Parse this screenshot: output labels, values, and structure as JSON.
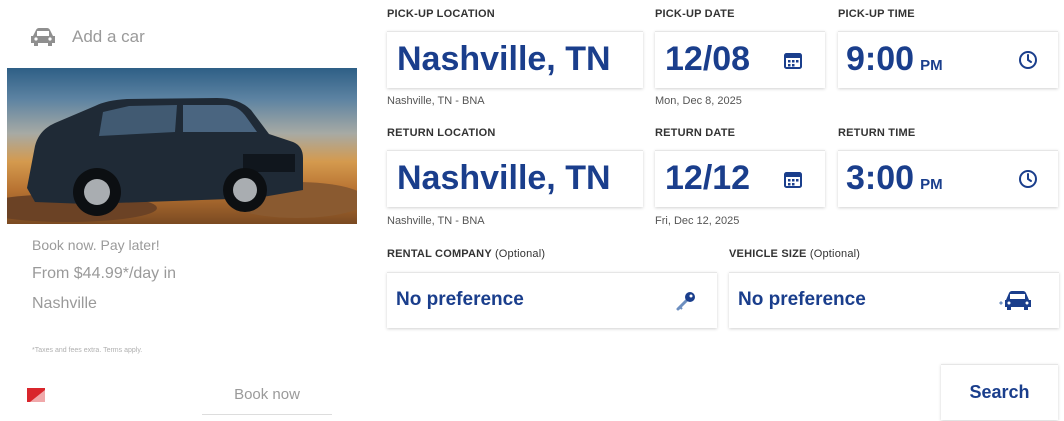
{
  "promo": {
    "add_car": "Add a car",
    "tagline": "Book now. Pay later!",
    "price_line1": "From $44.99*/day in",
    "price_line2": "Nashville",
    "disclaimer": "*Taxes and fees extra. Terms apply.",
    "book_now": "Book now"
  },
  "pickup": {
    "location_label": "PICK-UP LOCATION",
    "location_value": "Nashville, TN",
    "location_sub": "Nashville, TN - BNA",
    "date_label": "PICK-UP DATE",
    "date_value": "12/08",
    "date_sub": "Mon, Dec 8, 2025",
    "time_label": "PICK-UP TIME",
    "time_value": "9:00",
    "time_ampm": "PM"
  },
  "return": {
    "location_label": "RETURN LOCATION",
    "location_value": "Nashville, TN",
    "location_sub": "Nashville, TN - BNA",
    "date_label": "RETURN DATE",
    "date_value": "12/12",
    "date_sub": "Fri, Dec 12, 2025",
    "time_label": "RETURN TIME",
    "time_value": "3:00",
    "time_ampm": "PM"
  },
  "rental_company": {
    "label": "RENTAL COMPANY",
    "optional": "(Optional)",
    "value": "No preference"
  },
  "vehicle_size": {
    "label": "VEHICLE SIZE",
    "optional": "(Optional)",
    "value": "No preference"
  },
  "search_label": "Search",
  "colors": {
    "accent": "#1a3e8c",
    "flag_red": "#d9262c"
  },
  "icons": [
    "car-icon",
    "calendar-icon",
    "clock-icon",
    "key-icon",
    "car-front-icon",
    "flag-logo-icon"
  ]
}
